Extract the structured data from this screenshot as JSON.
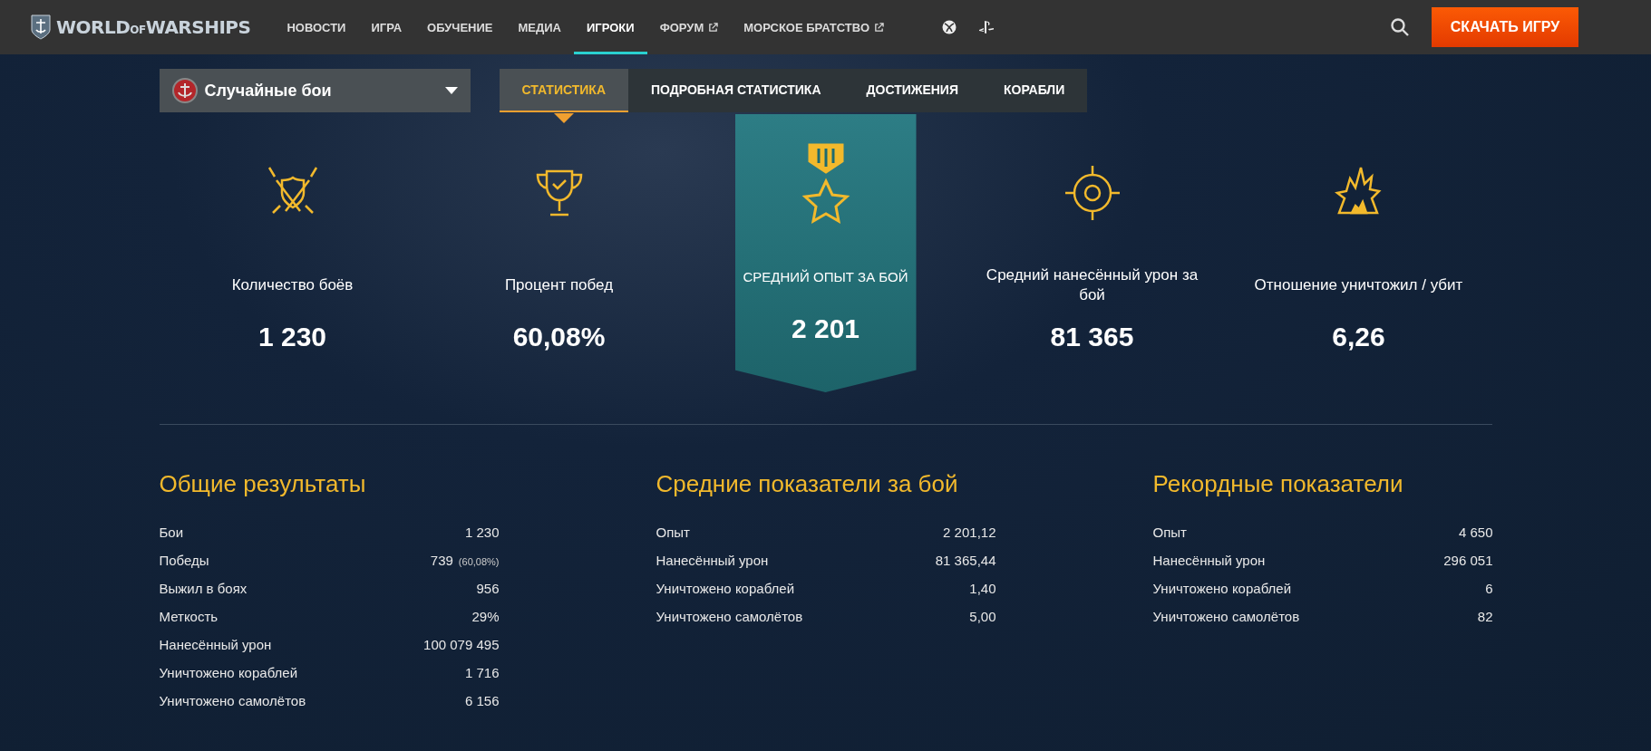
{
  "header": {
    "logo_main": "WORLD",
    "logo_of": "OF",
    "logo_end": "WARSHIPS",
    "nav": [
      {
        "label": "НОВОСТИ",
        "selected": false,
        "external": false
      },
      {
        "label": "ИГРА",
        "selected": false,
        "external": false
      },
      {
        "label": "ОБУЧЕНИЕ",
        "selected": false,
        "external": false
      },
      {
        "label": "МЕДИА",
        "selected": false,
        "external": false
      },
      {
        "label": "ИГРОКИ",
        "selected": true,
        "external": false
      },
      {
        "label": "ФОРУМ",
        "selected": false,
        "external": true
      },
      {
        "label": "МОРСКОЕ БРАТСТВО",
        "selected": false,
        "external": true
      }
    ],
    "download_button": "СКАЧАТЬ ИГРУ"
  },
  "mode_select": {
    "value": "Случайные бои"
  },
  "tabs": [
    {
      "label": "СТАТИСТИКА",
      "selected": true
    },
    {
      "label": "ПОДРОБНАЯ СТАТИСТИКА",
      "selected": false
    },
    {
      "label": "ДОСТИЖЕНИЯ",
      "selected": false
    },
    {
      "label": "КОРАБЛИ",
      "selected": false
    }
  ],
  "highlights": [
    {
      "kind": "battles",
      "label": "Количество боёв",
      "value": "1 230",
      "selected": false
    },
    {
      "kind": "wins",
      "label": "Процент побед",
      "value": "60,08%",
      "selected": false
    },
    {
      "kind": "experience",
      "label": "СРЕДНИЙ ОПЫТ ЗА БОЙ",
      "value": "2 201",
      "selected": true
    },
    {
      "kind": "damage",
      "label": "Средний нанесённый урон за бой",
      "value": "81 365",
      "selected": false
    },
    {
      "kind": "kills",
      "label": "Отношение уничтожил / убит",
      "value": "6,26",
      "selected": false
    }
  ],
  "sections": [
    {
      "title": "Общие результаты",
      "rows": [
        {
          "label": "Бои",
          "value": "1 230"
        },
        {
          "label": "Победы",
          "value": "739",
          "note": "(60,08%)"
        },
        {
          "label": "Выжил в боях",
          "value": "956"
        },
        {
          "label": "Меткость",
          "value": "29%"
        },
        {
          "label": "Нанесённый урон",
          "value": "100 079 495"
        },
        {
          "label": "Уничтожено кораблей",
          "value": "1 716"
        },
        {
          "label": "Уничтожено самолётов",
          "value": "6 156"
        }
      ]
    },
    {
      "title": "Средние показатели за бой",
      "rows": [
        {
          "label": "Опыт",
          "value": "2 201,12"
        },
        {
          "label": "Нанесённый урон",
          "value": "81 365,44"
        },
        {
          "label": "Уничтожено кораблей",
          "value": "1,40"
        },
        {
          "label": "Уничтожено самолётов",
          "value": "5,00"
        }
      ]
    },
    {
      "title": "Рекордные показатели",
      "rows": [
        {
          "label": "Опыт",
          "value": "4 650"
        },
        {
          "label": "Нанесённый урон",
          "value": "296 051"
        },
        {
          "label": "Уничтожено кораблей",
          "value": "6"
        },
        {
          "label": "Уничтожено самолётов",
          "value": "82"
        }
      ]
    }
  ]
}
